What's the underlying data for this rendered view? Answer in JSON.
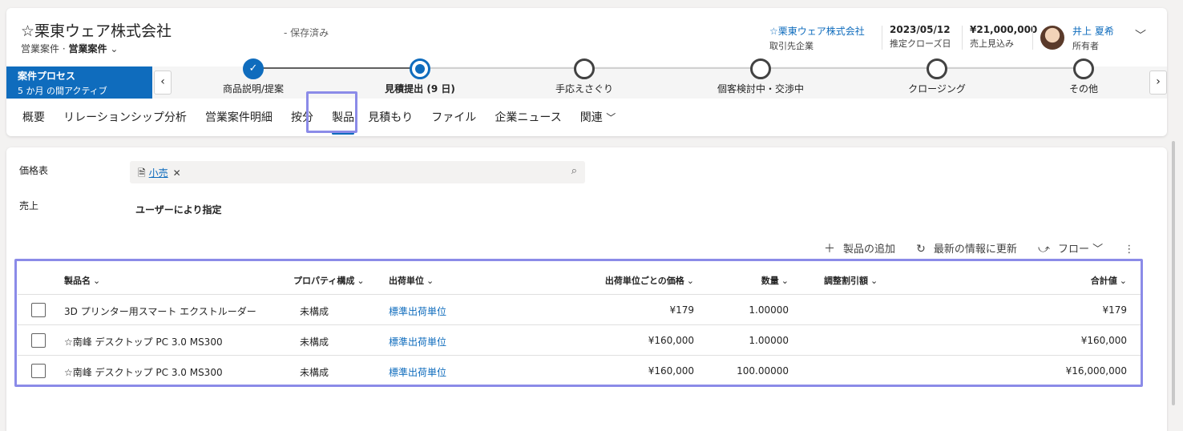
{
  "record": {
    "title": "☆栗東ウェア株式会社",
    "entity": "営業案件",
    "form": "営業案件",
    "save_status": "- 保存済み"
  },
  "header_fields": [
    {
      "value": "☆栗東ウェア株式会社",
      "label": "取引先企業"
    },
    {
      "value": "2023/05/12",
      "label": "推定クローズ日"
    },
    {
      "value": "¥21,000,000",
      "label": "売上見込み"
    },
    {
      "value": "井上 夏希",
      "label": "所有者"
    }
  ],
  "bpf": {
    "title": "案件プロセス",
    "subtitle": "5 か月 の間アクティブ",
    "stages": [
      {
        "label": "商品説明/提案",
        "state": "done"
      },
      {
        "label": "見積提出 (9 日)",
        "state": "current"
      },
      {
        "label": "手応えさぐり",
        "state": "todo"
      },
      {
        "label": "個客検討中・交渉中",
        "state": "todo"
      },
      {
        "label": "クロージング",
        "state": "todo"
      },
      {
        "label": "その他",
        "state": "todo"
      }
    ]
  },
  "tabs": [
    "概要",
    "リレーションシップ分析",
    "営業案件明細",
    "按分",
    "製品",
    "見積もり",
    "ファイル",
    "企業ニュース",
    "関連"
  ],
  "active_tab": "製品",
  "form": {
    "price_list_label": "価格表",
    "price_list_value": "小売",
    "sales_label": "売上",
    "sales_value": "ユーザーにより指定"
  },
  "commands": {
    "add_product": "製品の追加",
    "refresh": "最新の情報に更新",
    "flow": "フロー"
  },
  "grid": {
    "columns": [
      "製品名",
      "プロパティ構成",
      "出荷単位",
      "出荷単位ごとの価格",
      "数量",
      "調整割引額",
      "合計値"
    ],
    "rows": [
      {
        "name": "3D プリンター用スマート エクストルーダー",
        "config": "未構成",
        "unit": "標準出荷単位",
        "price": "¥179",
        "qty": "1.00000",
        "discount": "",
        "total": "¥179"
      },
      {
        "name": "☆南峰 デスクトップ PC 3.0 MS300",
        "config": "未構成",
        "unit": "標準出荷単位",
        "price": "¥160,000",
        "qty": "1.00000",
        "discount": "",
        "total": "¥160,000"
      },
      {
        "name": "☆南峰 デスクトップ PC 3.0 MS300",
        "config": "未構成",
        "unit": "標準出荷単位",
        "price": "¥160,000",
        "qty": "100.00000",
        "discount": "",
        "total": "¥16,000,000"
      }
    ]
  }
}
